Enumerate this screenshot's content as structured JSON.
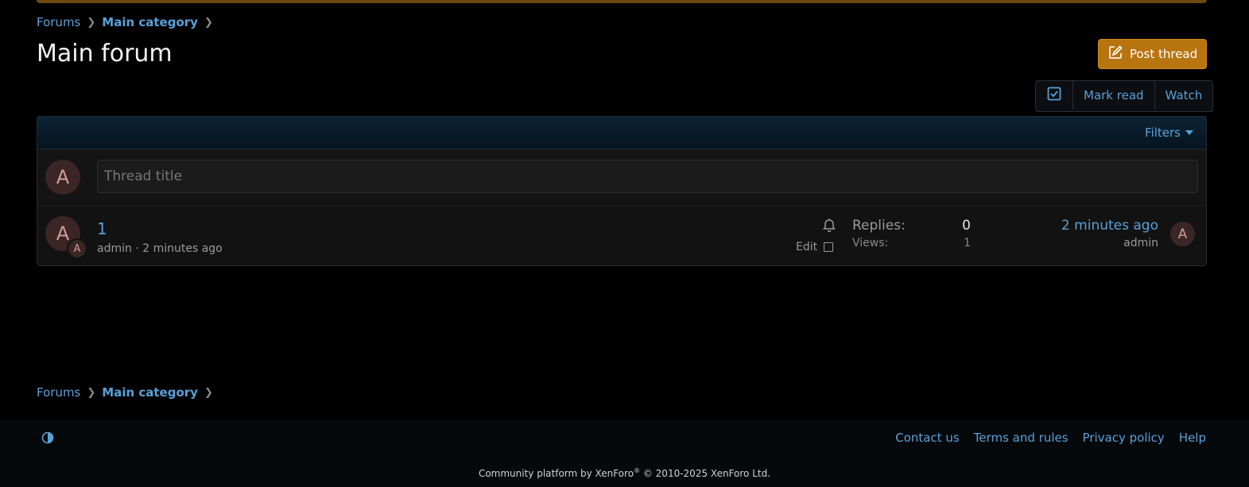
{
  "breadcrumb": {
    "root": "Forums",
    "category": "Main category"
  },
  "page": {
    "title": "Main forum"
  },
  "actions": {
    "post_thread": "Post thread",
    "mark_read": "Mark read",
    "watch": "Watch"
  },
  "filters": {
    "label": "Filters"
  },
  "new_thread": {
    "avatar_letter": "A",
    "placeholder": "Thread title"
  },
  "thread": {
    "avatar_letter": "A",
    "small_avatar_letter": "A",
    "title": "1",
    "author": "admin",
    "separator": " · ",
    "started": "2 minutes ago",
    "edit_label": "Edit",
    "replies_label": "Replies:",
    "replies_value": "0",
    "views_label": "Views:",
    "views_value": "1",
    "last_time": "2 minutes ago",
    "last_user": "admin",
    "last_avatar_letter": "A"
  },
  "footer": {
    "links": [
      "Contact us",
      "Terms and rules",
      "Privacy policy",
      "Help"
    ],
    "copyright_prefix": "Community platform by XenForo",
    "copyright_mark": "®",
    "copyright_suffix": " © 2010-2025 XenForo Ltd."
  },
  "colors": {
    "accent": "#5aa0d8",
    "post_button": "#b8740f",
    "background": "#000000"
  },
  "icons": {
    "post_thread": "edit-icon",
    "select": "checkbox-icon",
    "watch_thread": "bell-icon",
    "style_variation": "contrast-icon"
  }
}
